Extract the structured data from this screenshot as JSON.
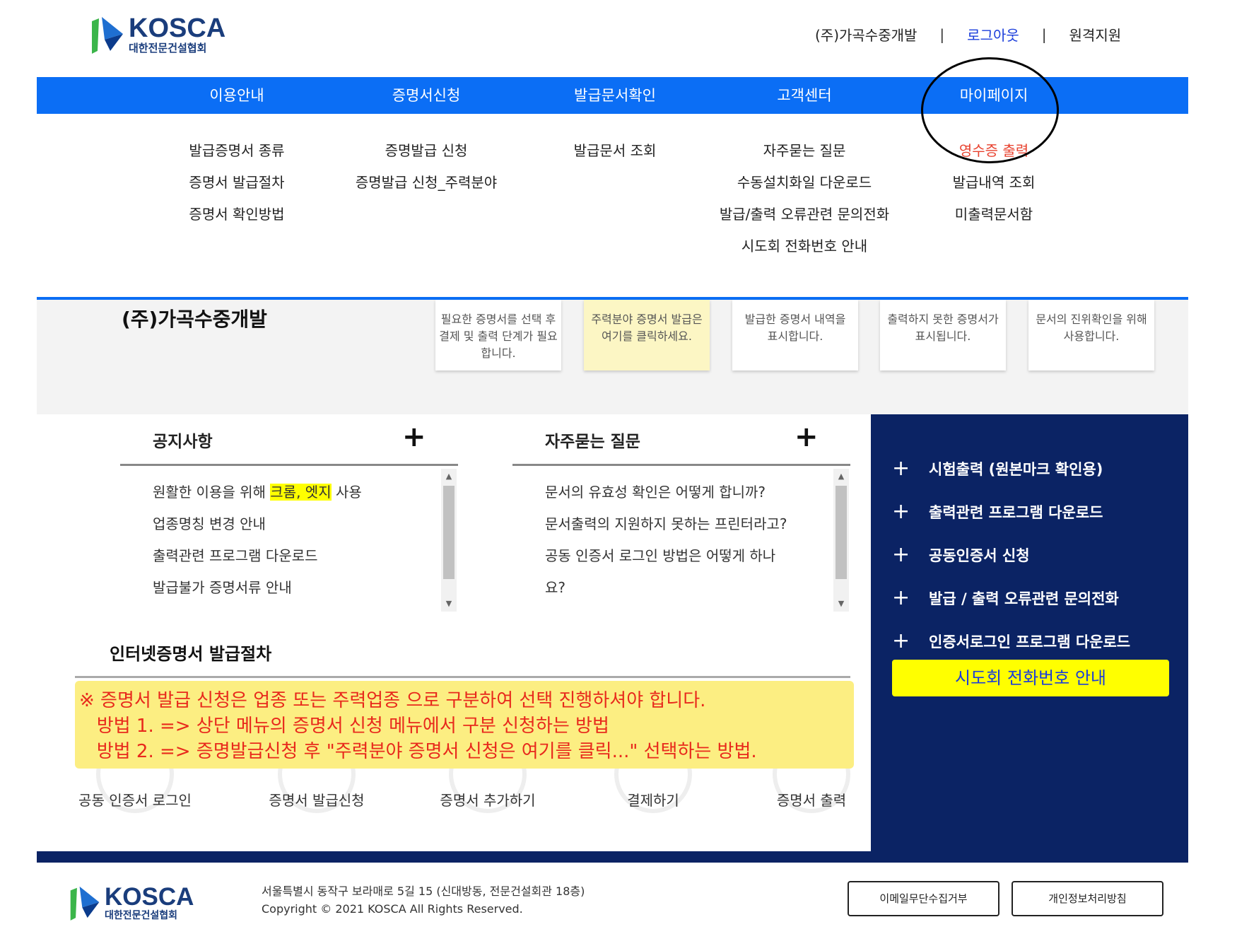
{
  "header": {
    "logo_en": "KOSCA",
    "logo_kr": "대한전문건설협회",
    "company": "(주)가곡수중개발",
    "logout": "로그아웃",
    "remote_support": "원격지원",
    "separator": "|"
  },
  "nav": [
    {
      "label": "이용안내",
      "sub": [
        "발급증명서 종류",
        "증명서 발급절차",
        "증명서 확인방법"
      ]
    },
    {
      "label": "증명서신청",
      "sub": [
        "증명발급 신청",
        "증명발급 신청_주력분야"
      ]
    },
    {
      "label": "발급문서확인",
      "sub": [
        "발급문서 조회"
      ]
    },
    {
      "label": "고객센터",
      "sub": [
        "자주묻는 질문",
        "수동설치화일 다운로드",
        "발급/출력 오류관련 문의전화",
        "시도회 전화번호 안내"
      ]
    },
    {
      "label": "마이페이지",
      "sub": [
        "영수증 출력",
        "발급내역 조회",
        "미출력문서함"
      ]
    }
  ],
  "banner": {
    "company": "(주)가곡수중개발",
    "cards": [
      {
        "lines": [
          "필요한 증명서를 선택 후",
          "결제 및 출력 단계가 필요",
          "합니다."
        ]
      },
      {
        "lines": [
          "주력분야 증명서 발급은",
          "여기를 클릭하세요."
        ]
      },
      {
        "lines": [
          "발급한 증명서 내역을",
          "표시합니다."
        ]
      },
      {
        "lines": [
          "출력하지 못한 증명서가",
          "표시됩니다."
        ]
      },
      {
        "lines": [
          "문서의 진위확인을 위해",
          "사용합니다."
        ]
      }
    ]
  },
  "notice": {
    "title": "공지사항",
    "plus": "+",
    "item0_pre": "원활한 이용을 위해 ",
    "item0_mark": "크롬, 엣지",
    "item0_post": " 사용",
    "items": [
      "업종명칭 변경 안내",
      "출력관련 프로그램 다운로드",
      "발급불가 증명서류 안내"
    ]
  },
  "faq": {
    "title": "자주묻는 질문",
    "plus": "+",
    "items": [
      "문서의 유효성 확인은 어떻게 합니까?",
      "문서출력의 지원하지 못하는 프린터라고?",
      "공동 인증서 로그인 방법은 어떻게 하나",
      "요?"
    ]
  },
  "quick_links": {
    "plus": "+",
    "items": [
      "시험출력 (원본마크 확인용)",
      "출력관련 프로그램 다운로드",
      "공동인증서 신청",
      "발급 / 출력 오류관련 문의전화",
      "인증서로그인 프로그램 다운로드"
    ],
    "button": "시도회 전화번호 안내"
  },
  "process": {
    "title": "인터넷증명서 발급절차",
    "steps": [
      "공동 인증서 로그인",
      "증명서 발급신청",
      "증명서 추가하기",
      "결제하기",
      "증명서 출력"
    ],
    "note": [
      "※ 증명서 발급 신청은 업종 또는 주력업종 으로 구분하여 선택 진행하셔야 합니다.",
      "   방법 1. => 상단 메뉴의 증명서 신청 메뉴에서 구분 신청하는 방법",
      "   방법 2. => 증명발급신청 후 \"주력분야 증명서 신청은 여기를 클릭...\" 선택하는 방법."
    ]
  },
  "footer": {
    "logo_en": "KOSCA",
    "logo_kr": "대한전문건설협회",
    "address": "서울특별시 동작구 보라매로 5길 15 (신대방동, 전문건설회관 18층)",
    "copyright": "Copyright © 2021 KOSCA All Rights Reserved.",
    "buttons": [
      "이메일무단수집거부",
      "개인정보처리방침"
    ]
  },
  "colors": {
    "nav_blue": "#0b6ef5",
    "navy": "#0b2364",
    "highlight_red": "#e8422f",
    "link_blue": "#1a3ddb",
    "yellow": "#ffff00"
  }
}
